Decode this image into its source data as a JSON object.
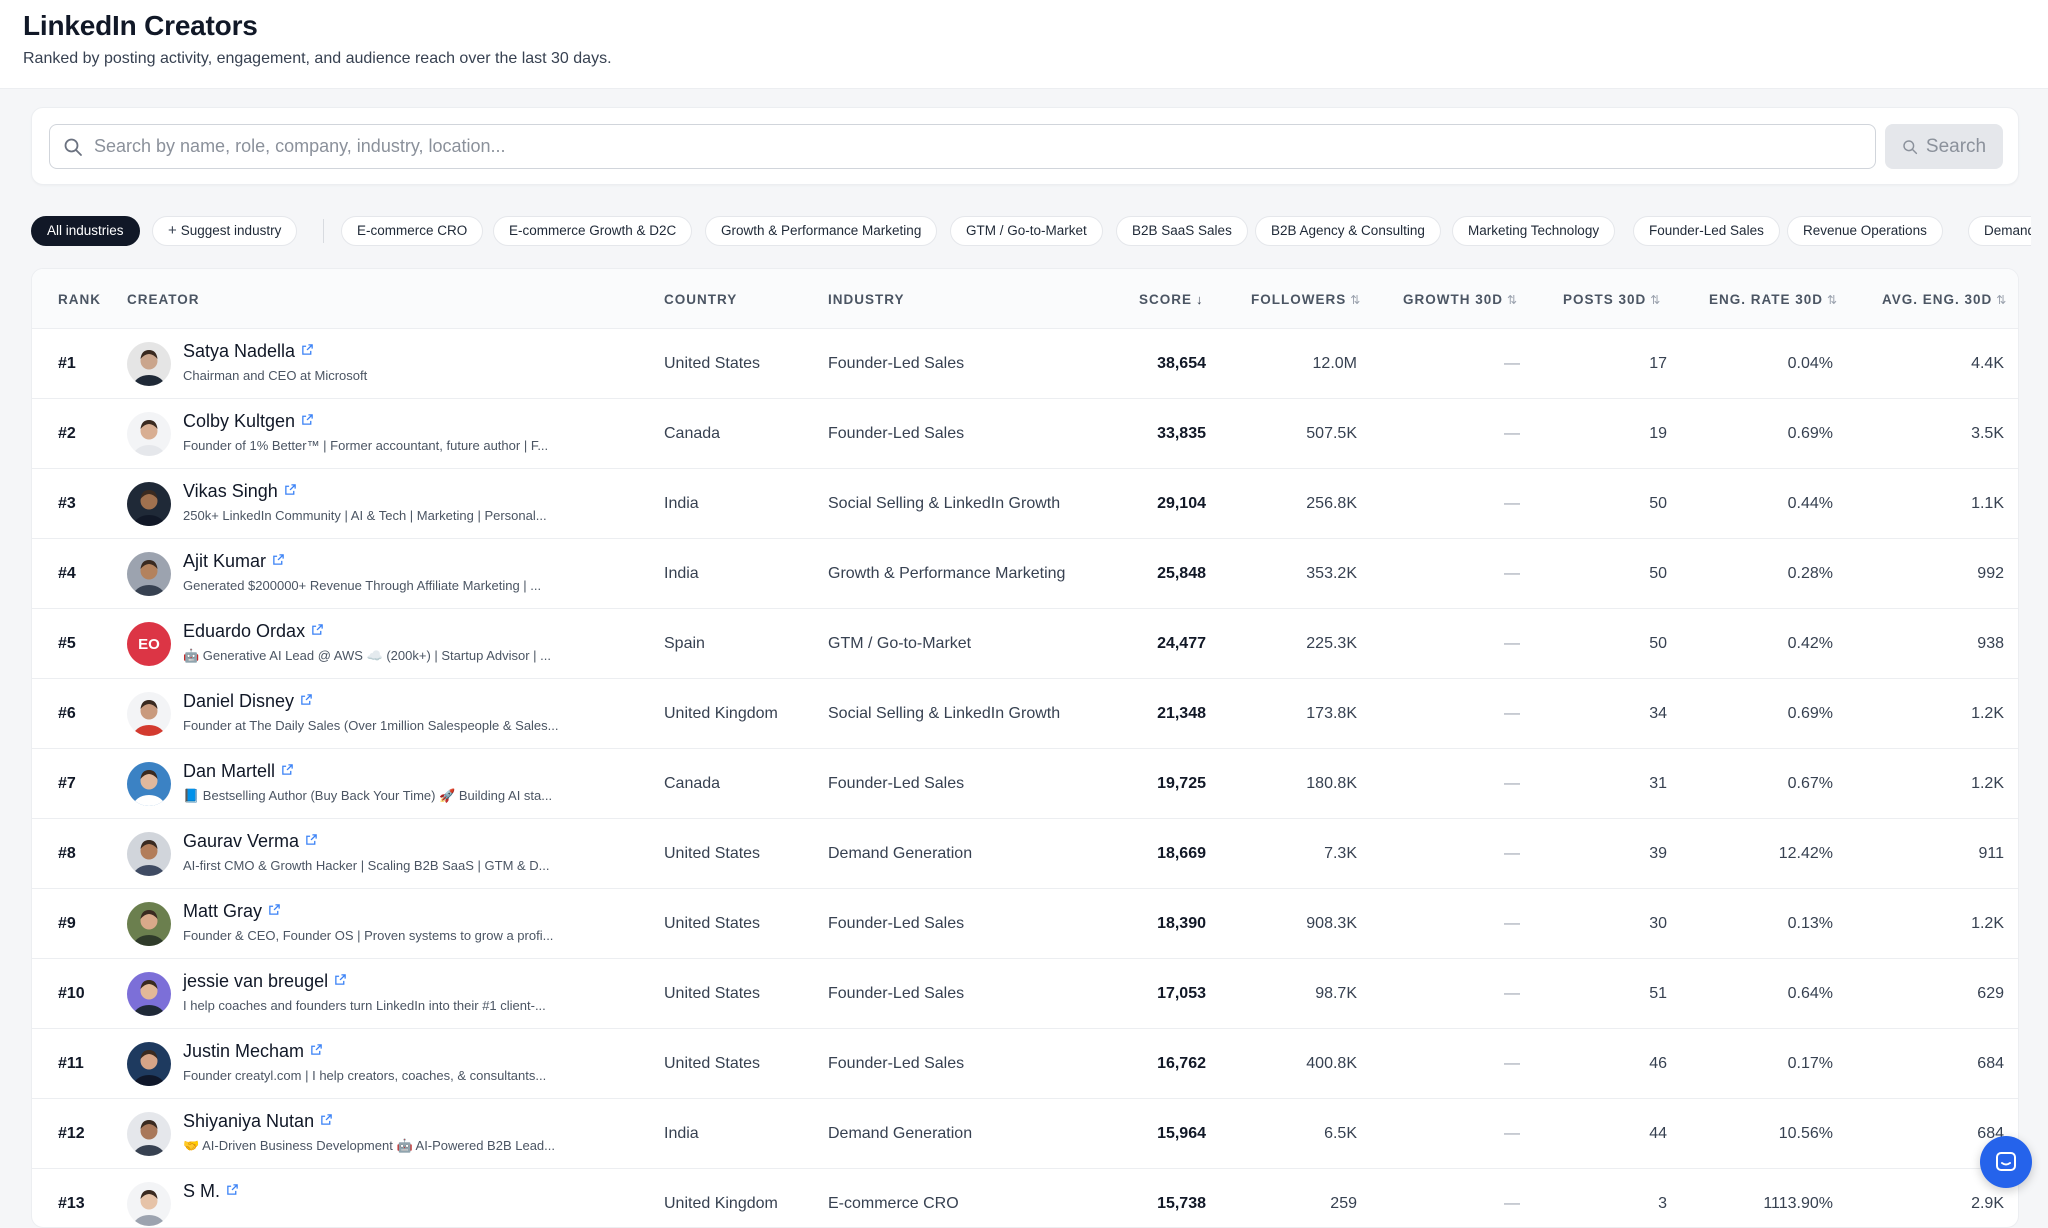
{
  "header": {
    "title": "LinkedIn Creators",
    "subtitle": "Ranked by posting activity, engagement, and audience reach over the last 30 days."
  },
  "search": {
    "placeholder": "Search by name, role, company, industry, location...",
    "value": "",
    "button_label": "Search"
  },
  "filters": {
    "all_label": "All industries",
    "suggest_label": "Suggest industry",
    "industries": [
      "E-commerce CRO",
      "E-commerce Growth & D2C",
      "Growth & Performance Marketing",
      "GTM / Go-to-Market",
      "B2B SaaS Sales",
      "B2B Agency & Consulting",
      "Marketing Technology",
      "Founder-Led Sales",
      "Revenue Operations",
      "Demand"
    ]
  },
  "table": {
    "columns": {
      "rank": "RANK",
      "creator": "CREATOR",
      "country": "COUNTRY",
      "industry": "INDUSTRY",
      "score": "SCORE",
      "followers": "FOLLOWERS",
      "growth": "GROWTH 30D",
      "posts": "POSTS 30D",
      "eng_rate": "ENG. RATE 30D",
      "avg_eng": "AVG. ENG. 30D"
    },
    "sort_active_icon": "↓",
    "sort_icon": "⇅",
    "rows": [
      {
        "rank": "#1",
        "name": "Satya Nadella",
        "desc": "Chairman and CEO at Microsoft",
        "country": "United States",
        "industry": "Founder-Led Sales",
        "score": "38,654",
        "followers": "12.0M",
        "growth": "—",
        "posts": "17",
        "eng_rate": "0.04%",
        "avg_eng": "4.4K",
        "avatar_color": "#e5e5e5",
        "avatar_skin": "#caa58c",
        "avatar_shirt": "#1f2937"
      },
      {
        "rank": "#2",
        "name": "Colby Kultgen",
        "desc": "Founder of 1% Better™ | Former accountant, future author | F...",
        "country": "Canada",
        "industry": "Founder-Led Sales",
        "score": "33,835",
        "followers": "507.5K",
        "growth": "—",
        "posts": "19",
        "eng_rate": "0.69%",
        "avg_eng": "3.5K",
        "avatar_color": "#f3f4f6",
        "avatar_skin": "#d8ae92",
        "avatar_shirt": "#e5e7eb"
      },
      {
        "rank": "#3",
        "name": "Vikas Singh",
        "desc": "250k+ LinkedIn Community | AI & Tech | Marketing | Personal...",
        "country": "India",
        "industry": "Social Selling & LinkedIn Growth",
        "score": "29,104",
        "followers": "256.8K",
        "growth": "—",
        "posts": "50",
        "eng_rate": "0.44%",
        "avg_eng": "1.1K",
        "avatar_color": "#1f2937",
        "avatar_skin": "#a0714f",
        "avatar_shirt": "#111827"
      },
      {
        "rank": "#4",
        "name": "Ajit Kumar",
        "desc": "Generated $200000+ Revenue Through Affiliate Marketing | ...",
        "country": "India",
        "industry": "Growth & Performance Marketing",
        "score": "25,848",
        "followers": "353.2K",
        "growth": "—",
        "posts": "50",
        "eng_rate": "0.28%",
        "avg_eng": "992",
        "avatar_color": "#9ca3af",
        "avatar_skin": "#b3825d",
        "avatar_shirt": "#374151"
      },
      {
        "rank": "#5",
        "name": "Eduardo Ordax",
        "desc": "🤖 Generative AI Lead @ AWS ☁️ (200k+) | Startup Advisor | ...",
        "country": "Spain",
        "industry": "GTM / Go-to-Market",
        "score": "24,477",
        "followers": "225.3K",
        "growth": "—",
        "posts": "50",
        "eng_rate": "0.42%",
        "avg_eng": "938",
        "avatar_initials": "EO",
        "avatar_color": "#dc3545"
      },
      {
        "rank": "#6",
        "name": "Daniel Disney",
        "desc": "Founder at The Daily Sales (Over 1million Salespeople & Sales...",
        "country": "United Kingdom",
        "industry": "Social Selling & LinkedIn Growth",
        "score": "21,348",
        "followers": "173.8K",
        "growth": "—",
        "posts": "34",
        "eng_rate": "0.69%",
        "avg_eng": "1.2K",
        "avatar_color": "#f3f4f6",
        "avatar_skin": "#c99a7d",
        "avatar_shirt": "#d33a2f"
      },
      {
        "rank": "#7",
        "name": "Dan Martell",
        "desc": "📘 Bestselling Author (Buy Back Your Time) 🚀 Building AI sta...",
        "country": "Canada",
        "industry": "Founder-Led Sales",
        "score": "19,725",
        "followers": "180.8K",
        "growth": "—",
        "posts": "31",
        "eng_rate": "0.67%",
        "avg_eng": "1.2K",
        "avatar_color": "#3b82c4",
        "avatar_skin": "#e0b89d",
        "avatar_shirt": "#ffffff"
      },
      {
        "rank": "#8",
        "name": "Gaurav Verma",
        "desc": "AI-first CMO & Growth Hacker | Scaling B2B SaaS | GTM & D...",
        "country": "United States",
        "industry": "Demand Generation",
        "score": "18,669",
        "followers": "7.3K",
        "growth": "—",
        "posts": "39",
        "eng_rate": "12.42%",
        "avg_eng": "911",
        "avatar_color": "#d1d5db",
        "avatar_skin": "#b27d5a",
        "avatar_shirt": "#3f4b63"
      },
      {
        "rank": "#9",
        "name": "Matt Gray",
        "desc": "Founder & CEO, Founder OS | Proven systems to grow a profi...",
        "country": "United States",
        "industry": "Founder-Led Sales",
        "score": "18,390",
        "followers": "908.3K",
        "growth": "—",
        "posts": "30",
        "eng_rate": "0.13%",
        "avg_eng": "1.2K",
        "avatar_color": "#6b7f4e",
        "avatar_skin": "#d9a98a",
        "avatar_shirt": "#2f3b2a"
      },
      {
        "rank": "#10",
        "name": "jessie van breugel",
        "desc": "I help coaches and founders turn LinkedIn into their #1 client-...",
        "country": "United States",
        "industry": "Founder-Led Sales",
        "score": "17,053",
        "followers": "98.7K",
        "growth": "—",
        "posts": "51",
        "eng_rate": "0.64%",
        "avg_eng": "629",
        "avatar_color": "#7c6fd8",
        "avatar_skin": "#e3b898",
        "avatar_shirt": "#1f2937"
      },
      {
        "rank": "#11",
        "name": "Justin Mecham",
        "desc": "Founder creatyl.com | I help creators, coaches, & consultants...",
        "country": "United States",
        "industry": "Founder-Led Sales",
        "score": "16,762",
        "followers": "400.8K",
        "growth": "—",
        "posts": "46",
        "eng_rate": "0.17%",
        "avg_eng": "684",
        "avatar_color": "#1e3a5f",
        "avatar_skin": "#d6a487",
        "avatar_shirt": "#0f172a"
      },
      {
        "rank": "#12",
        "name": "Shiyaniya Nutan",
        "desc": "🤝 AI-Driven Business Development 🤖 AI-Powered B2B Lead...",
        "country": "India",
        "industry": "Demand Generation",
        "score": "15,964",
        "followers": "6.5K",
        "growth": "—",
        "posts": "44",
        "eng_rate": "10.56%",
        "avg_eng": "684",
        "avatar_color": "#e5e7eb",
        "avatar_skin": "#a9785a",
        "avatar_shirt": "#374151"
      },
      {
        "rank": "#13",
        "name": "S M.",
        "desc": "",
        "country": "United Kingdom",
        "industry": "E-commerce CRO",
        "score": "15,738",
        "followers": "259",
        "growth": "—",
        "posts": "3",
        "eng_rate": "1113.90%",
        "avg_eng": "2.9K",
        "avatar_color": "#f3f4f6",
        "avatar_skin": "#e6c3a8",
        "avatar_shirt": "#9ca3af"
      }
    ]
  },
  "colors": {
    "accent": "#111827",
    "chat_button": "#2563eb",
    "initials_avatar": "#dc3545"
  },
  "icons": {
    "search": "search-icon",
    "external_link": "external-link-icon",
    "plus": "plus-icon",
    "chat": "chat-icon"
  }
}
